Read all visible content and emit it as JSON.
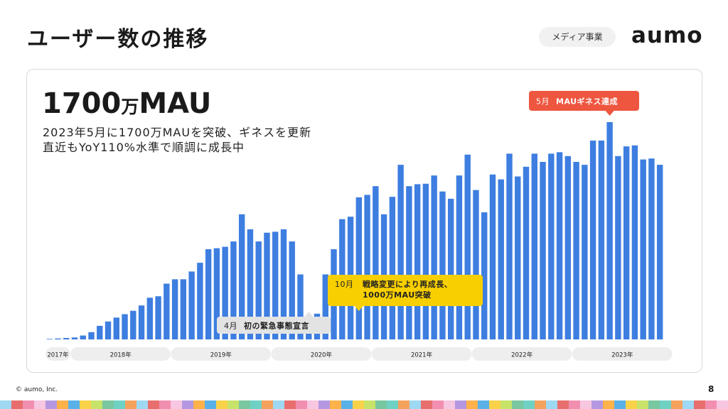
{
  "page": {
    "title": "ユーザー数の推移",
    "tag": "メディア事業",
    "logo": "aumo",
    "footer": "© aumo, Inc.",
    "page_number": "8"
  },
  "headline": {
    "value": "1700",
    "unit": "万",
    "suffix": "MAU",
    "line1": "2023年5月に1700万MAUを突破、ギネスを更新",
    "line2": "直近もYoY110%水準で順調に成長中"
  },
  "colors": {
    "bar": "#3d7ee0",
    "callout_red": "#ee5640",
    "callout_yellow": "#f8cf00",
    "callout_gray": "#e3e3e3",
    "year_pill": "#eeeeee"
  },
  "chart_data": {
    "type": "bar",
    "ylim": [
      0,
      1700
    ],
    "years": [
      {
        "label": "2017年",
        "start": 0,
        "count": 3
      },
      {
        "label": "2018年",
        "start": 3,
        "count": 12
      },
      {
        "label": "2019年",
        "start": 15,
        "count": 12
      },
      {
        "label": "2020年",
        "start": 27,
        "count": 12
      },
      {
        "label": "2021年",
        "start": 39,
        "count": 12
      },
      {
        "label": "2022年",
        "start": 51,
        "count": 12
      },
      {
        "label": "2023年",
        "start": 63,
        "count": 12
      }
    ],
    "values": [
      5,
      10,
      15,
      20,
      40,
      75,
      140,
      185,
      225,
      260,
      295,
      350,
      430,
      445,
      575,
      620,
      620,
      700,
      790,
      930,
      940,
      955,
      1010,
      1290,
      1135,
      1010,
      1100,
      1110,
      1135,
      1010,
      670,
      145,
      265,
      670,
      930,
      1240,
      1265,
      1465,
      1490,
      1580,
      1290,
      1470,
      1800,
      1580,
      1600,
      1605,
      1690,
      1525,
      1450,
      1690,
      1905,
      1540,
      1310,
      1700,
      1650,
      1915,
      1680,
      1780,
      1915,
      1830,
      1915,
      1930,
      1890,
      1830,
      1800,
      2050,
      2050,
      2240,
      1890,
      1990,
      2000,
      1855,
      1865,
      1800
    ],
    "callouts": [
      {
        "bar": 31,
        "label": "4月",
        "text": "初の緊急事態宣言"
      },
      {
        "bar": 37,
        "label": "10月",
        "text": "戦略変更により再成長、",
        "text2": "1000万MAU突破"
      },
      {
        "bar": 67,
        "label": "5月",
        "text": "MAUギネス達成"
      }
    ]
  }
}
